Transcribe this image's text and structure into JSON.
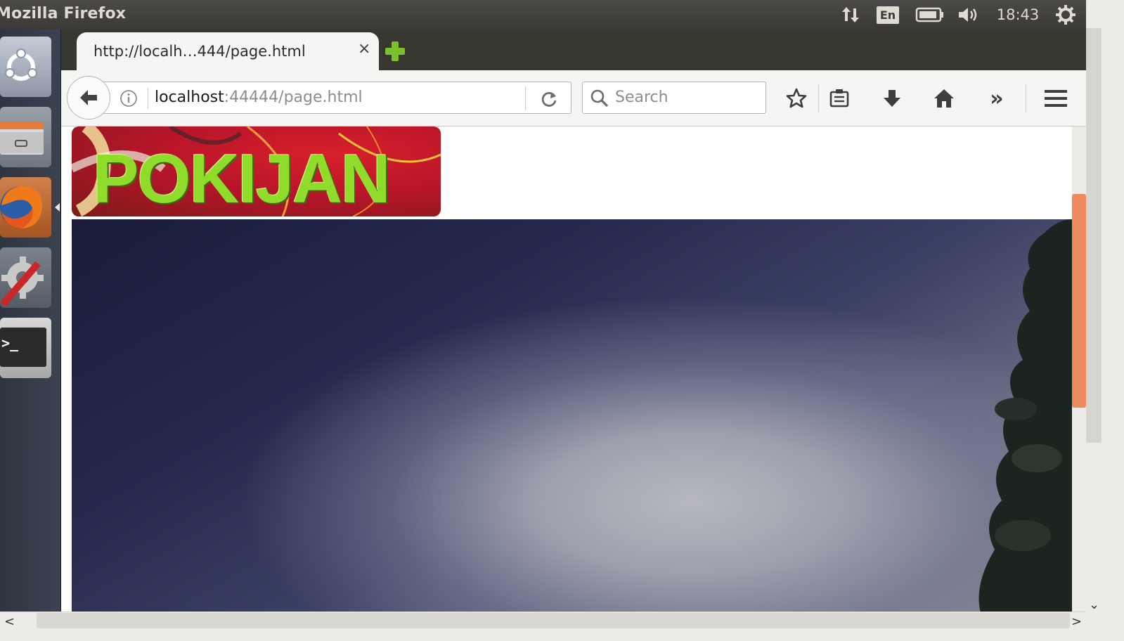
{
  "window": {
    "title": "Mozilla Firefox"
  },
  "panel": {
    "lang": "En",
    "clock": "18:43",
    "icons": [
      "network-icon",
      "keyboard-language-icon",
      "battery-icon",
      "volume-icon",
      "power-gear-icon"
    ]
  },
  "launcher": {
    "items": [
      "ubuntu-dash",
      "files",
      "firefox",
      "system-settings",
      "terminal"
    ],
    "terminal_prompt": ">_"
  },
  "tab": {
    "title": "http://localh…444/page.html",
    "close": "×"
  },
  "navbar": {
    "url_host": "localhost",
    "url_rest": ":44444/page.html",
    "search_placeholder": "Search",
    "overflow": "»"
  },
  "page": {
    "logo_text": "POKIJAN"
  },
  "scroll": {
    "vertical_position": 0.2,
    "left_arrow": "<",
    "right_arrow": ">",
    "down_arrow": "⌄"
  },
  "colors": {
    "accent_scroll": "#ef8a5e",
    "logo_green": "#8fdc2a",
    "logo_red": "#c8182a"
  }
}
